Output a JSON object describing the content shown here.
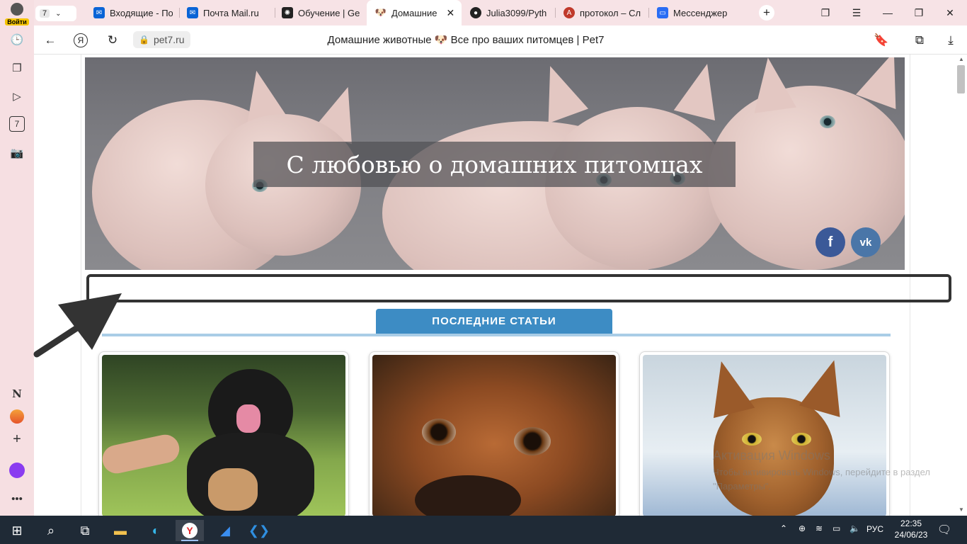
{
  "browser": {
    "account_label": "Войти",
    "tab_counter": "7",
    "tabs": [
      {
        "label": "Входящие - По",
        "icon": "outlook-icon",
        "color": "#0a64d6"
      },
      {
        "label": "Почта Mail.ru",
        "icon": "mail-icon",
        "color": "#0a64d6"
      },
      {
        "label": "Обучение | Ge",
        "icon": "openai-icon",
        "color": "#222222"
      },
      {
        "label": "Домашние",
        "icon": "dog-icon",
        "color": "#ffffff"
      },
      {
        "label": "Julia3099/Pyth",
        "icon": "github-icon",
        "color": "#222222"
      },
      {
        "label": "протокол – Сл",
        "icon": "dictionary-icon",
        "color": "#c0392b"
      },
      {
        "label": "Мессенджер",
        "icon": "messenger-icon",
        "color": "#2a6df4"
      }
    ],
    "url": "pet7.ru",
    "page_title": "Домашние животные 🐶 Все про ваших питомцев | Pet7"
  },
  "sidebar": {
    "item_7": "7"
  },
  "page": {
    "hero_title": "С любовью о домашних питомцах",
    "facebook_label": "f",
    "vk_label": "vk",
    "section_title": "ПОСЛЕДНИЕ СТАТЬИ"
  },
  "watermark": {
    "line1": "Активация Windows",
    "line2": "Чтобы активировать Windows, перейдите в раздел \"Параметры\"."
  },
  "taskbar": {
    "lang": "РУС",
    "time": "22:35",
    "date": "24/06/23"
  }
}
